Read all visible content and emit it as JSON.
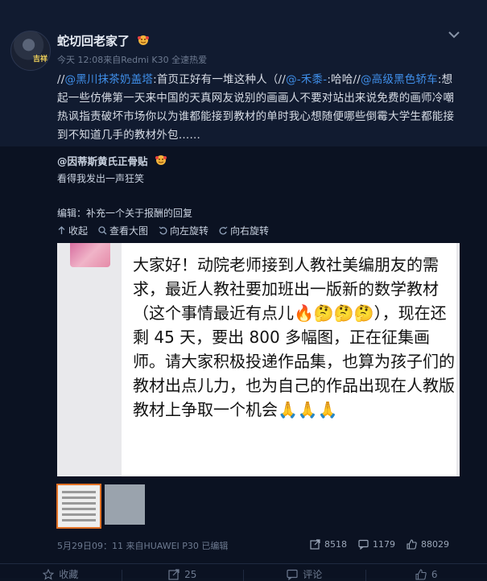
{
  "post": {
    "username": "蛇切回老家了",
    "avatar_label": "吉祥",
    "meta": "今天 12:08来自Redmi K30 全速热爱",
    "text_parts": {
      "p1": "//",
      "m1": "@黑川抹茶奶盖塔",
      "p2": ":首页正好有一堆这种人（//",
      "m2": "@-禾黍-",
      "p3": ":哈哈//",
      "m3": "@高级黑色轿车",
      "p4": ":想起一些仿佛第一天来中国的天真网友说别的画画人不要对站出来说免费的画师冷嘲热讽指责破坏市场你以为谁都能接到教材的单时我心想随便哪些倒霉大学生都能接到不知道几手的教材外包……"
    }
  },
  "repost": {
    "username": "@因蒂斯黄氏正骨贴",
    "text": "看得我发出一声狂笑",
    "edit_note": "编辑：补充一个关于报酬的回复",
    "tools": {
      "collapse": "收起",
      "view_large": "查看大图",
      "rotate_left": "向左旋转",
      "rotate_right": "向右旋转"
    },
    "image_text": "大家好！动院老师接到人教社美编朋友的需求，最近人教社要加班出一版新的数学教材（这个事情最近有点儿🔥🤔🤔🤔），现在还剩 45 天，要出 800 多幅图，正在征集画师。请大家积极投递作品集，也算为孩子们的教材出点儿力，也为自己的作品出现在人教版教材上争取一个机会🙏🙏🙏",
    "meta": "5月29日09：11 来自HUAWEI P30 已编辑",
    "stats": {
      "reposts": "8518",
      "comments": "1179",
      "likes": "88029"
    }
  },
  "actions": {
    "favorite": "收藏",
    "repost": "25",
    "comment": "评论",
    "like": "6"
  },
  "colors": {
    "accent": "#3f8ee8",
    "background": "#0e1628",
    "thumb_selected": "#e27124"
  }
}
